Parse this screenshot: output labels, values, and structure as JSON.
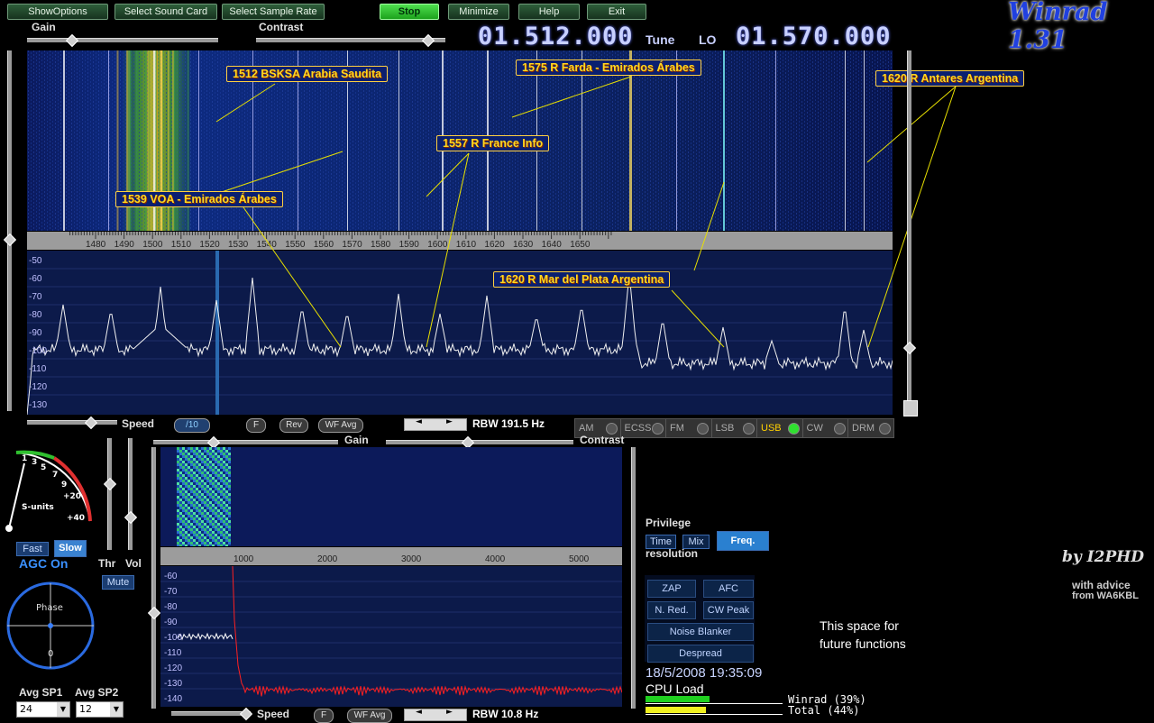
{
  "app": {
    "title": "Winrad 1.31"
  },
  "toolbar": {
    "show_options": "ShowOptions",
    "select_sound_card": "Select Sound Card",
    "select_sample_rate": "Select Sample Rate",
    "stop": "Stop",
    "minimize": "Minimize",
    "help": "Help",
    "exit": "Exit"
  },
  "top_controls": {
    "gain": "Gain",
    "contrast": "Contrast"
  },
  "frequency": {
    "tune_value": "01.512.000",
    "tune_label": "Tune",
    "lo_label": "LO",
    "lo_value": "01.570.000"
  },
  "waterfall": {
    "ticks": [
      "1480",
      "1490",
      "1500",
      "1510",
      "1520",
      "1530",
      "1540",
      "1550",
      "1560",
      "1570",
      "1580",
      "1590",
      "1600",
      "1610",
      "1620",
      "1630",
      "1640",
      "1650"
    ],
    "annotations": {
      "a1512": "1512 BSKSA Arabia Saudita",
      "a1575": "1575 R Farda - Emirados Árabes",
      "a1620ant": "1620 R Antares Argentina",
      "a1557": "1557 R France Info",
      "a1539": "1539 VOA - Emirados Árabes",
      "a1620mdp": "1620 R Mar del Plata Argentina"
    }
  },
  "spectrum": {
    "y_ticks": [
      "-50",
      "-60",
      "-70",
      "-80",
      "-90",
      "-100",
      "-110",
      "-120",
      "-130"
    ]
  },
  "lower_bar": {
    "speed": "Speed",
    "speed_value": "/10",
    "f": "F",
    "rev": "Rev",
    "wf_avg": "WF Avg",
    "rbw": "RBW 191.5 Hz",
    "gain": "Gain",
    "contrast": "Contrast"
  },
  "modes": [
    {
      "label": "AM",
      "active": false
    },
    {
      "label": "ECSS",
      "active": false
    },
    {
      "label": "FM",
      "active": false
    },
    {
      "label": "LSB",
      "active": false
    },
    {
      "label": "USB",
      "active": true
    },
    {
      "label": "CW",
      "active": false
    },
    {
      "label": "DRM",
      "active": false
    }
  ],
  "smeter": {
    "label": "S-units",
    "scale": [
      "1",
      "3",
      "5",
      "7",
      "9",
      "+20",
      "+40"
    ]
  },
  "agc": {
    "fast": "Fast",
    "slow": "Slow",
    "status": "AGC On",
    "thr": "Thr",
    "vol": "Vol",
    "mute": "Mute"
  },
  "phase": {
    "label": "Phase",
    "zero": "0"
  },
  "avg": {
    "sp1_label": "Avg SP1",
    "sp1_value": "24",
    "sp2_label": "Avg SP2",
    "sp2_value": "12"
  },
  "audio_panel": {
    "ticks": [
      "1000",
      "2000",
      "3000",
      "4000",
      "5000"
    ],
    "y_ticks": [
      "-60",
      "-70",
      "-80",
      "-90",
      "-100",
      "-110",
      "-120",
      "-130",
      "-140"
    ],
    "speed": "Speed",
    "f": "F",
    "wf_avg": "WF Avg",
    "rbw": "RBW 10.8 Hz"
  },
  "privilege": {
    "title": "Privilege",
    "time": "Time",
    "mix": "Mix",
    "freq": "Freq.",
    "resolution": "resolution"
  },
  "functions": {
    "zap": "ZAP",
    "afc": "AFC",
    "nred": "N. Red.",
    "cwpeak": "CW Peak",
    "noise_blanker": "Noise Blanker",
    "despread": "Despread"
  },
  "status": {
    "datetime": "18/5/2008 19:35:09",
    "cpu_load": "CPU Load",
    "winrad": "Winrad (39%)",
    "total": "Total (44%)",
    "winrad_pct": 39,
    "total_pct": 44
  },
  "future": {
    "line1": "This space for",
    "line2": "future functions"
  },
  "credits": {
    "by": "by I2PHD",
    "advice1": "with advice",
    "advice2": "from WA6KBL"
  }
}
